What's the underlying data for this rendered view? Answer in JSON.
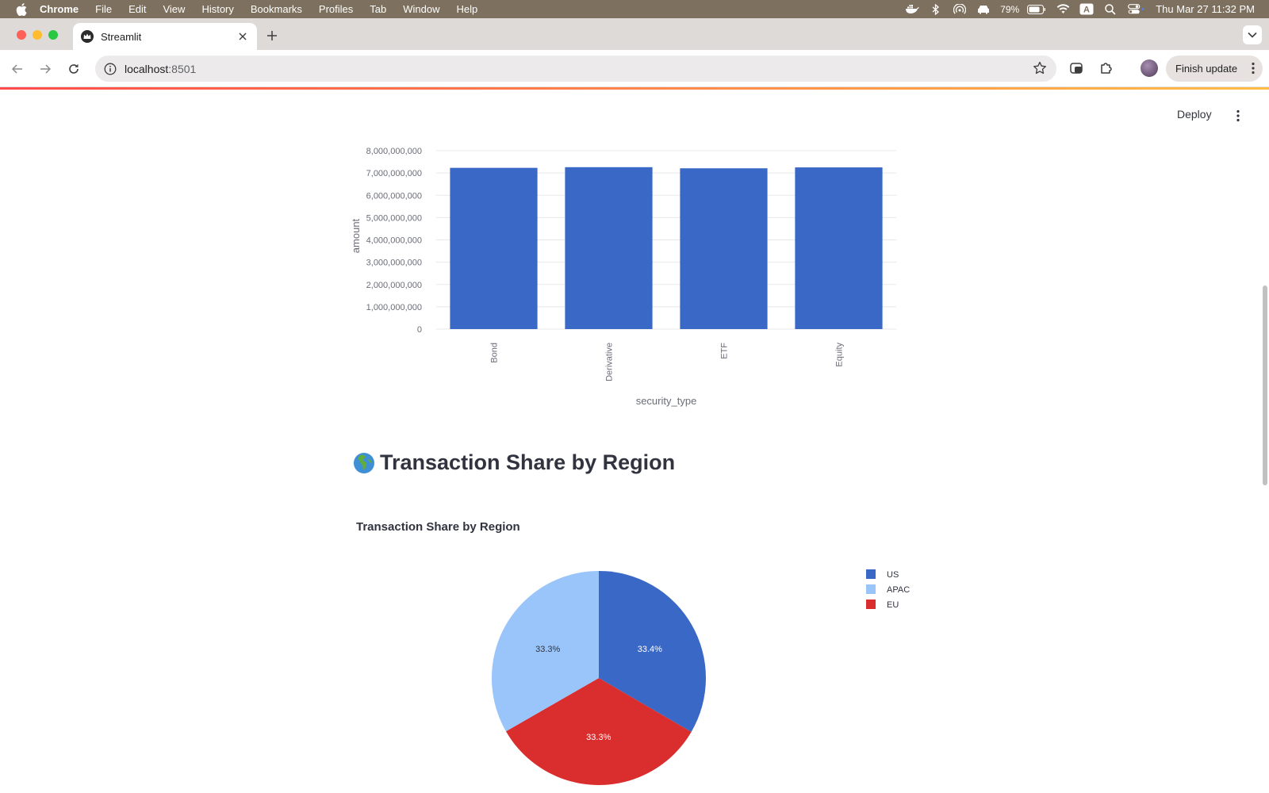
{
  "menubar": {
    "app_name": "Chrome",
    "items": [
      "File",
      "Edit",
      "View",
      "History",
      "Bookmarks",
      "Profiles",
      "Tab",
      "Window",
      "Help"
    ],
    "battery": "79%",
    "input_source": "A",
    "clock": "Thu Mar 27  11:32 PM"
  },
  "browser": {
    "tab_title": "Streamlit",
    "url_host": "localhost",
    "url_port": ":8501",
    "finish_update_label": "Finish update"
  },
  "app": {
    "deploy_label": "Deploy",
    "section_emoji": "globe-africa-icon",
    "section_title": "Transaction Share by Region",
    "pie_chart_title": "Transaction Share by Region"
  },
  "colors": {
    "bar": "#3a68c6",
    "us": "#3a68c6",
    "apac": "#9ac5fa",
    "eu": "#da2d2d",
    "accent_red": "#ff4b4b",
    "accent_yellow": "#ffbd45"
  },
  "chart_data": [
    {
      "type": "bar",
      "categories": [
        "Bond",
        "Derivative",
        "ETF",
        "Equity"
      ],
      "values": [
        7230000000,
        7260000000,
        7210000000,
        7250000000
      ],
      "title": "",
      "xlabel": "security_type",
      "ylabel": "amount",
      "ylim": [
        0,
        8000000000
      ],
      "yticks": [
        0,
        1000000000,
        2000000000,
        3000000000,
        4000000000,
        5000000000,
        6000000000,
        7000000000,
        8000000000
      ],
      "ytick_labels": [
        "0",
        "1,000,000,000",
        "2,000,000,000",
        "3,000,000,000",
        "4,000,000,000",
        "5,000,000,000",
        "6,000,000,000",
        "7,000,000,000",
        "8,000,000,000"
      ],
      "grid": true,
      "legend": "none"
    },
    {
      "type": "pie",
      "title": "Transaction Share by Region",
      "labels": [
        "US",
        "EU",
        "APAC"
      ],
      "values": [
        33.4,
        33.3,
        33.3
      ],
      "value_labels": [
        "33.4%",
        "33.3%",
        "33.3%"
      ],
      "legend_order": [
        "US",
        "APAC",
        "EU"
      ],
      "legend": "top-right"
    }
  ]
}
